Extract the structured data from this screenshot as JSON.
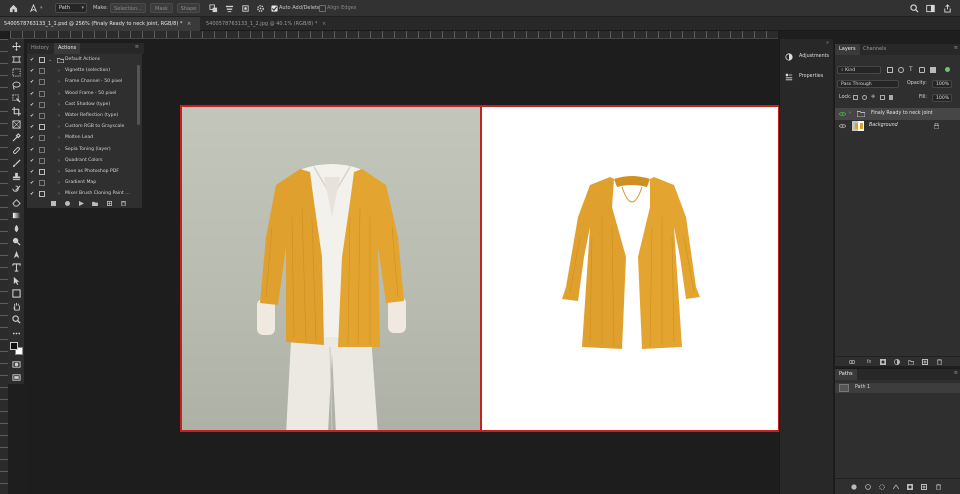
{
  "options_bar": {
    "mode_value": "Path",
    "make_label": "Make:",
    "selection_button": "Selection...",
    "mask_button": "Mask",
    "shape_button": "Shape",
    "auto_add_delete": "Auto Add/Delete",
    "align_edges": "Align Edges"
  },
  "tabs": [
    {
      "label": "5400578763133_1_1.psd @ 256% (Finaly Ready to neck joint, RGB/8) *",
      "close": "×"
    },
    {
      "label": "5400578763133_1_2.jpg @ 40.1% (RGB/8) *",
      "close": "×"
    }
  ],
  "history_panel": {
    "tabs": [
      "History",
      "Actions"
    ],
    "actions": [
      {
        "label": "Default Actions",
        "folder": true
      },
      {
        "label": "Vignette (selection)"
      },
      {
        "label": "Frame Channel - 50 pixel"
      },
      {
        "label": "Wood Frame - 50 pixel"
      },
      {
        "label": "Cast Shadow (type)"
      },
      {
        "label": "Water Reflection (type)"
      },
      {
        "label": "Custom RGB to Grayscale"
      },
      {
        "label": "Molten Lead"
      },
      {
        "label": "Sepia Toning (layer)"
      },
      {
        "label": "Quadrant Colors"
      },
      {
        "label": "Save as Photoshop PDF"
      },
      {
        "label": "Gradient Map"
      },
      {
        "label": "Mixer Brush Cloning Paint ..."
      }
    ]
  },
  "dock": {
    "adjustments": "Adjustments",
    "properties": "Properties"
  },
  "layers_panel": {
    "tabs": [
      "Layers",
      "Channels"
    ],
    "kind_filter": "Kind",
    "blend_mode": "Pass Through",
    "opacity_label": "Opacity:",
    "opacity_value": "100%",
    "lock_label": "Lock:",
    "fill_label": "Fill:",
    "fill_value": "100%",
    "layers": [
      {
        "name": "Finaly Ready to neck joint",
        "type": "group",
        "selected": true
      },
      {
        "name": "Background",
        "type": "image",
        "selected": false
      }
    ]
  },
  "paths_panel": {
    "title": "Paths",
    "paths": [
      {
        "name": "Path 1"
      }
    ]
  },
  "colors": {
    "canvas_border": "#c62020",
    "cardigan": "#e0a02e",
    "accent_eye": "#4caf50"
  }
}
